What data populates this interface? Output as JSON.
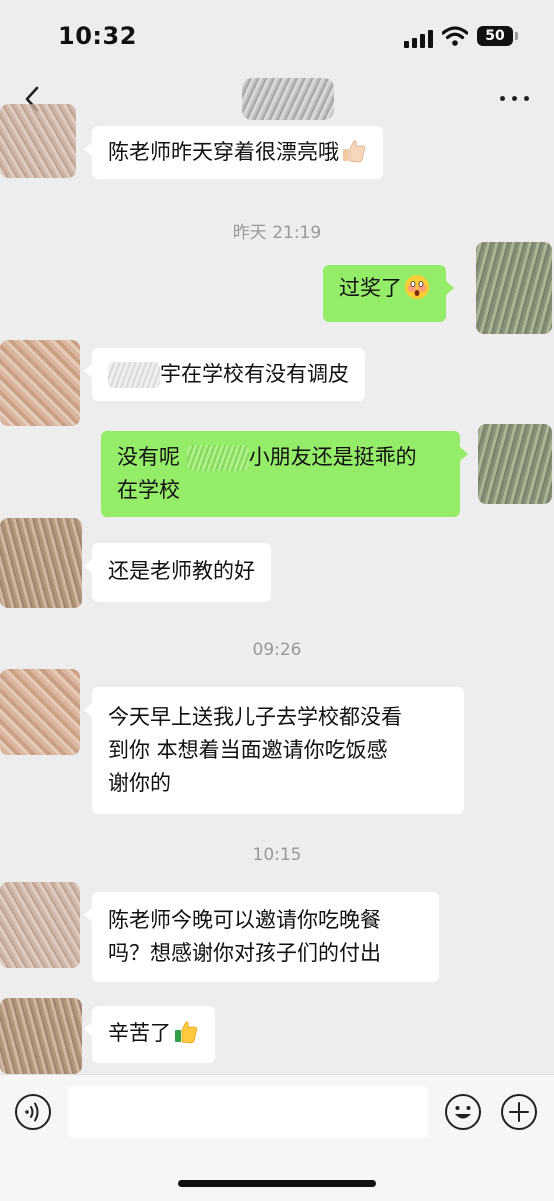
{
  "status_bar": {
    "time": "10:32",
    "battery": "50"
  },
  "nav": {
    "title": ""
  },
  "messages": [
    {
      "kind": "msg",
      "side": "in",
      "text": "陈老师昨天穿着很漂亮哦",
      "emoji": "thumbs-up-icon"
    },
    {
      "kind": "time",
      "text": "昨天 21:19"
    },
    {
      "kind": "msg",
      "side": "out",
      "text": "过奖了",
      "emoji": "shy-face-icon"
    },
    {
      "kind": "msg",
      "side": "in",
      "text_before": "",
      "text_after": "宇在学校有没有调皮"
    },
    {
      "kind": "msg",
      "side": "out",
      "text_before": "没有呢 ",
      "text_after": "小朋友还是挺乖的",
      "line2": "在学校"
    },
    {
      "kind": "msg",
      "side": "in",
      "text": "还是老师教的好"
    },
    {
      "kind": "time",
      "text": "09:26"
    },
    {
      "kind": "msg",
      "side": "in",
      "lines": [
        "今天早上送我儿子去学校都没看",
        "到你 本想着当面邀请你吃饭感",
        "谢你的"
      ]
    },
    {
      "kind": "time",
      "text": "10:15"
    },
    {
      "kind": "msg",
      "side": "in",
      "lines": [
        "陈老师今晚可以邀请你吃晚餐",
        "吗？想感谢你对孩子们的付出"
      ]
    },
    {
      "kind": "msg",
      "side": "in",
      "text": "辛苦了",
      "emoji": "thumbs-up-icon"
    }
  ],
  "input_bar": {
    "placeholder": ""
  }
}
